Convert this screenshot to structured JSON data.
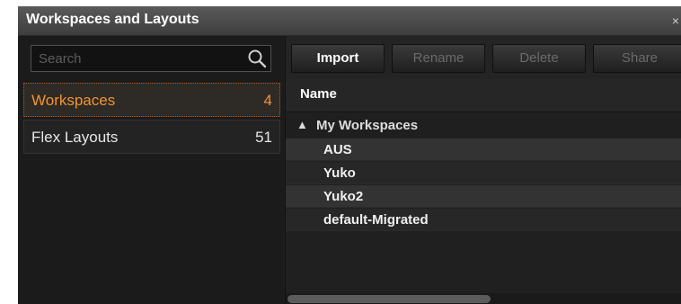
{
  "window": {
    "title": "Workspaces and Layouts",
    "close_glyph": "×"
  },
  "search": {
    "placeholder": "Search",
    "value": "",
    "icon": "search-icon"
  },
  "sidebar": {
    "items": [
      {
        "label": "Workspaces",
        "count": "4",
        "selected": true
      },
      {
        "label": "Flex Layouts",
        "count": "51",
        "selected": false
      }
    ],
    "accent_color": "#f29430"
  },
  "toolbar": {
    "import_label": "Import",
    "rename_label": "Rename",
    "delete_label": "Delete",
    "share_label": "Share"
  },
  "table": {
    "column_header": "Name",
    "group": {
      "arrow": "▲",
      "label": "My Workspaces"
    },
    "rows": [
      "AUS",
      "Yuko",
      "Yuko2",
      "default-Migrated"
    ]
  }
}
